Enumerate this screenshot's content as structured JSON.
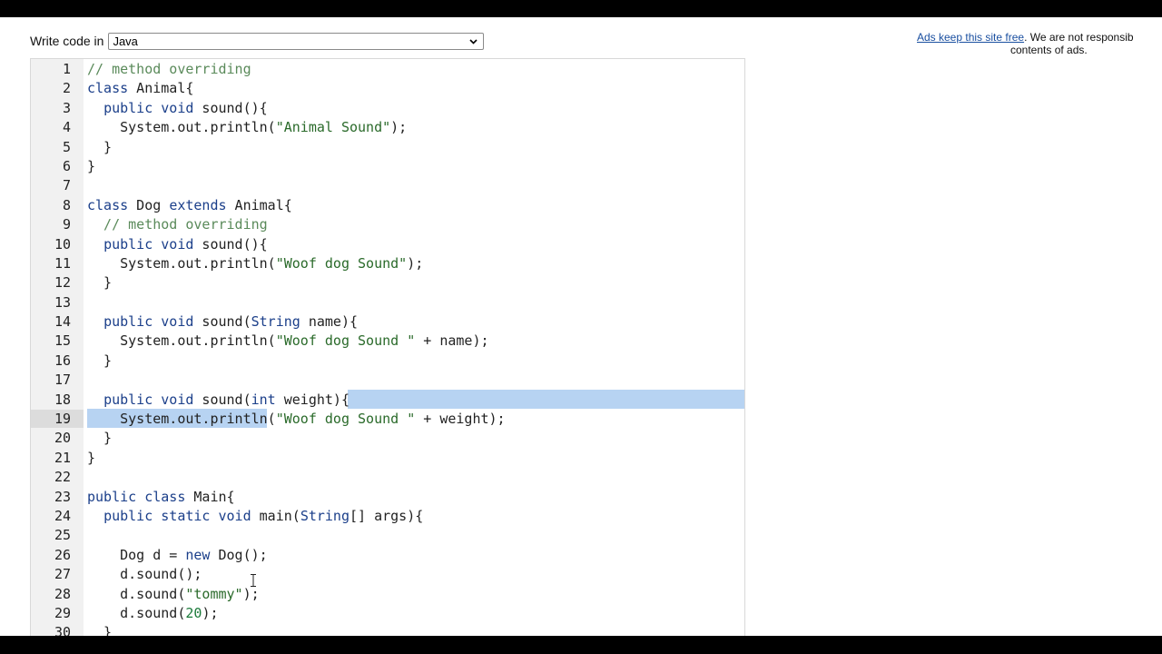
{
  "toolbar": {
    "label": "Write code in",
    "language": "Java"
  },
  "ads": {
    "link_text": "Ads keep this site free",
    "text_line1": ". We are not responsib",
    "text_line2": "contents of ads."
  },
  "editor": {
    "lines": [
      {
        "n": "1",
        "code": "// method overriding"
      },
      {
        "n": "2",
        "code": "class Animal{"
      },
      {
        "n": "3",
        "code": "  public void sound(){"
      },
      {
        "n": "4",
        "code": "    System.out.println(\"Animal Sound\");"
      },
      {
        "n": "5",
        "code": "  }"
      },
      {
        "n": "6",
        "code": "}"
      },
      {
        "n": "7",
        "code": ""
      },
      {
        "n": "8",
        "code": "class Dog extends Animal{"
      },
      {
        "n": "9",
        "code": "  // method overriding"
      },
      {
        "n": "10",
        "code": "  public void sound(){"
      },
      {
        "n": "11",
        "code": "    System.out.println(\"Woof dog Sound\");"
      },
      {
        "n": "12",
        "code": "  }"
      },
      {
        "n": "13",
        "code": ""
      },
      {
        "n": "14",
        "code": "  public void sound(String name){"
      },
      {
        "n": "15",
        "code": "    System.out.println(\"Woof dog Sound \" + name);"
      },
      {
        "n": "16",
        "code": "  }"
      },
      {
        "n": "17",
        "code": ""
      },
      {
        "n": "18",
        "code": "  public void sound(int weight){"
      },
      {
        "n": "19",
        "code": "    System.out.println(\"Woof dog Sound \" + weight);"
      },
      {
        "n": "20",
        "code": "  }"
      },
      {
        "n": "21",
        "code": "}"
      },
      {
        "n": "22",
        "code": ""
      },
      {
        "n": "23",
        "code": "public class Main{"
      },
      {
        "n": "24",
        "code": "  public static void main(String[] args){"
      },
      {
        "n": "25",
        "code": ""
      },
      {
        "n": "26",
        "code": "    Dog d = new Dog();"
      },
      {
        "n": "27",
        "code": "    d.sound();"
      },
      {
        "n": "28",
        "code": "    d.sound(\"tommy\");"
      },
      {
        "n": "29",
        "code": "    d.sound(20);"
      },
      {
        "n": "30",
        "code": "  }"
      }
    ],
    "active_line": "19"
  }
}
